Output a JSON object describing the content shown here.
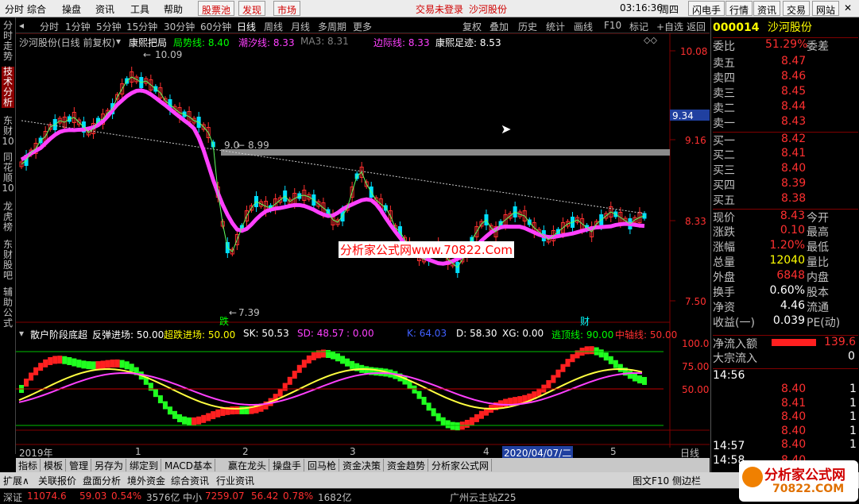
{
  "menubar": {
    "items": [
      "分时",
      "综合",
      "操盘",
      "资讯",
      "工具",
      "帮助"
    ],
    "buttons": [
      "股票池",
      "发现",
      "市场"
    ],
    "login_notice": "交易未登录",
    "stock_name": "沙河股份",
    "clock": "03:16:36",
    "weekday": "周四",
    "right_buttons": [
      "闪电手",
      "行情",
      "资讯",
      "交易",
      "网站"
    ]
  },
  "left_tabs": [
    "分时走势",
    "技术分析",
    "东财10",
    "同花顺10",
    "龙虎榜",
    "东财股吧",
    "辅助公式"
  ],
  "toolbar": {
    "items": [
      "分时",
      "1分钟",
      "5分钟",
      "15分钟",
      "30分钟",
      "60分钟",
      "日线",
      "周线",
      "月线",
      "多周期",
      "更多"
    ],
    "right_items": [
      "复权",
      "叠加",
      "历史",
      "统计",
      "画线",
      "F10",
      "标记",
      "+自选",
      "返回"
    ]
  },
  "main_chart": {
    "title": "沙河股份(日线 前复权)",
    "indicator_name": "康熙把局",
    "legend": [
      {
        "label": "局势线: 8.40",
        "color": "#00ff00"
      },
      {
        "label": "潮汐线: 8.33",
        "color": "#ff40ff"
      },
      {
        "label": "MA3: 8.31",
        "color": "#808080"
      },
      {
        "label": "边际线: 8.33",
        "color": "#ff40ff"
      },
      {
        "label": "康熙足迹: 8.53",
        "color": "#ffffff"
      }
    ],
    "price_axis": [
      "10.08",
      "9.16",
      "8.33",
      "7.50"
    ],
    "current_price_tag": "9.34",
    "high_label": "10.09",
    "low_label": "7.39",
    "mid_label_left": "9.0",
    "mid_label_right": "8.99",
    "signal_down": "跌",
    "signal_cai": "财"
  },
  "sub_chart": {
    "title": "散户阶段底超",
    "legend": [
      {
        "label": "反弹进场: 50.00",
        "color": "#ffffff"
      },
      {
        "label": "超跌进场: 50.00",
        "color": "#ffff00"
      },
      {
        "label": "SK: 50.53",
        "color": "#ffffff"
      },
      {
        "label": "SD: 48.57",
        "color": "#ff40ff"
      },
      {
        "label": ": 0.00",
        "color": "#ff40ff"
      },
      {
        "label": "K: 64.03",
        "color": "#4060ff"
      },
      {
        "label": "D: 58.30",
        "color": "#ffffff"
      },
      {
        "label": "XG: 0.00",
        "color": "#ffffff"
      },
      {
        "label": "逃顶线: 90.00",
        "color": "#00ff00"
      },
      {
        "label": "中轴线: 50.00",
        "color": "#ff3030"
      }
    ],
    "axis": [
      "100.0",
      "75.00",
      "50.00"
    ]
  },
  "date_axis": {
    "year": "2019年",
    "ticks": [
      "1",
      "2",
      "3",
      "4",
      "5"
    ],
    "cursor_date": "2020/04/07/二",
    "period": "日线"
  },
  "bottom_tabs": [
    "指标",
    "模板",
    "管理",
    "另存为",
    "绑定到",
    "MACD基本",
    "赢在龙头",
    "操盘手",
    "回马枪",
    "资金决策",
    "资金趋势",
    "分析家公式网"
  ],
  "status_tabs": [
    "扩展∧",
    "关联报价",
    "盘面分析",
    "境外资金",
    "综合资讯",
    "行业资讯"
  ],
  "status_right": [
    "图文F10",
    "侧边栏"
  ],
  "index_bar": {
    "name1": "深证",
    "val1": "11074.6",
    "chg1": "59.03",
    "pct1": "0.54%",
    "amt1": "3576亿",
    "name2": "中小",
    "val2": "7259.07",
    "chg2": "56.42",
    "pct2": "0.78%",
    "amt2": "1682亿",
    "broker": "广州云主站Z25"
  },
  "quote": {
    "code": "000014",
    "name": "沙河股份",
    "weibi_label": "委比",
    "weibi": "51.29%",
    "weicha_label": "委差",
    "sell": [
      {
        "label": "卖五",
        "price": "8.47"
      },
      {
        "label": "卖四",
        "price": "8.46"
      },
      {
        "label": "卖三",
        "price": "8.45"
      },
      {
        "label": "卖二",
        "price": "8.44"
      },
      {
        "label": "卖一",
        "price": "8.43"
      }
    ],
    "buy": [
      {
        "label": "买一",
        "price": "8.42"
      },
      {
        "label": "买二",
        "price": "8.41"
      },
      {
        "label": "买三",
        "price": "8.40"
      },
      {
        "label": "买四",
        "price": "8.39"
      },
      {
        "label": "买五",
        "price": "8.38"
      }
    ],
    "stats": [
      {
        "l1": "现价",
        "v1": "8.43",
        "c1": "red",
        "l2": "今开"
      },
      {
        "l1": "涨跌",
        "v1": "0.10",
        "c1": "red",
        "l2": "最高"
      },
      {
        "l1": "涨幅",
        "v1": "1.20%",
        "c1": "red",
        "l2": "最低"
      },
      {
        "l1": "总量",
        "v1": "12040",
        "c1": "yel",
        "l2": "量比"
      },
      {
        "l1": "外盘",
        "v1": "6848",
        "c1": "red",
        "l2": "内盘"
      },
      {
        "l1": "换手",
        "v1": "0.60%",
        "c1": "wht",
        "l2": "股本"
      },
      {
        "l1": "净资",
        "v1": "4.46",
        "c1": "wht",
        "l2": "流通"
      },
      {
        "l1": "收益(一)",
        "v1": "0.039",
        "c1": "wht",
        "l2": "PE(动)"
      }
    ],
    "netflow_label": "净流入额",
    "netflow": "139.6",
    "bigflow_label": "大宗流入",
    "bigflow": "0",
    "ticks_time1": "14:56",
    "ticks1": [
      "8.40",
      "8.41",
      "8.40",
      "8.40",
      "8.40"
    ],
    "ticks_time2": "14:57",
    "ticks2": [
      "8.40"
    ],
    "tick_tail": [
      "1",
      "1",
      "1",
      "1",
      "1",
      "1"
    ]
  },
  "watermark": "分析家公式网www.70822.Com",
  "logo": {
    "line1": "分析家公式网",
    "line2": "70822.COM"
  }
}
